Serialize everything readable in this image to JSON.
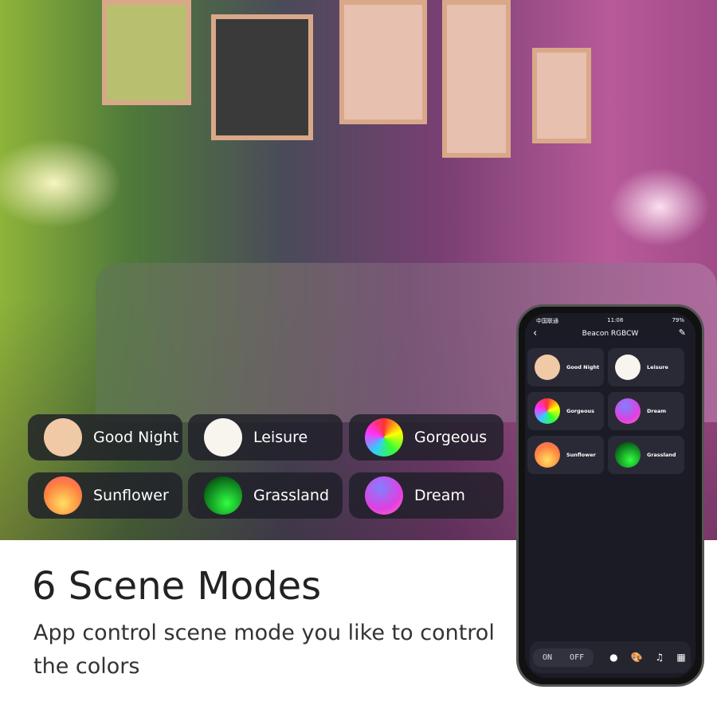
{
  "scenes": [
    {
      "label": "Good Night",
      "swatch": "#f0c9a6"
    },
    {
      "label": "Leisure",
      "swatch": "#f8f4ee"
    },
    {
      "label": "Gorgeous",
      "swatch": "multicolor"
    },
    {
      "label": "Sunflower",
      "swatch": "orange-yellow"
    },
    {
      "label": "Grassland",
      "swatch": "green"
    },
    {
      "label": "Dream",
      "swatch": "purple-pink"
    }
  ],
  "headline": "6 Scene Modes",
  "subtitle": "App control scene mode you like to control the colors",
  "phone": {
    "status": {
      "carrier": "中国联通",
      "time": "11:08",
      "battery": "79%"
    },
    "title": "Beacon RGBCW",
    "tiles": [
      "Good Night",
      "Leisure",
      "Gorgeous",
      "Dream",
      "Sunflower",
      "Grassland"
    ],
    "on_label": "ON",
    "off_label": "OFF",
    "nav_icons": [
      "bulb-icon",
      "palette-icon",
      "music-icon",
      "grid-icon"
    ],
    "accent": "#3aa0ff"
  }
}
